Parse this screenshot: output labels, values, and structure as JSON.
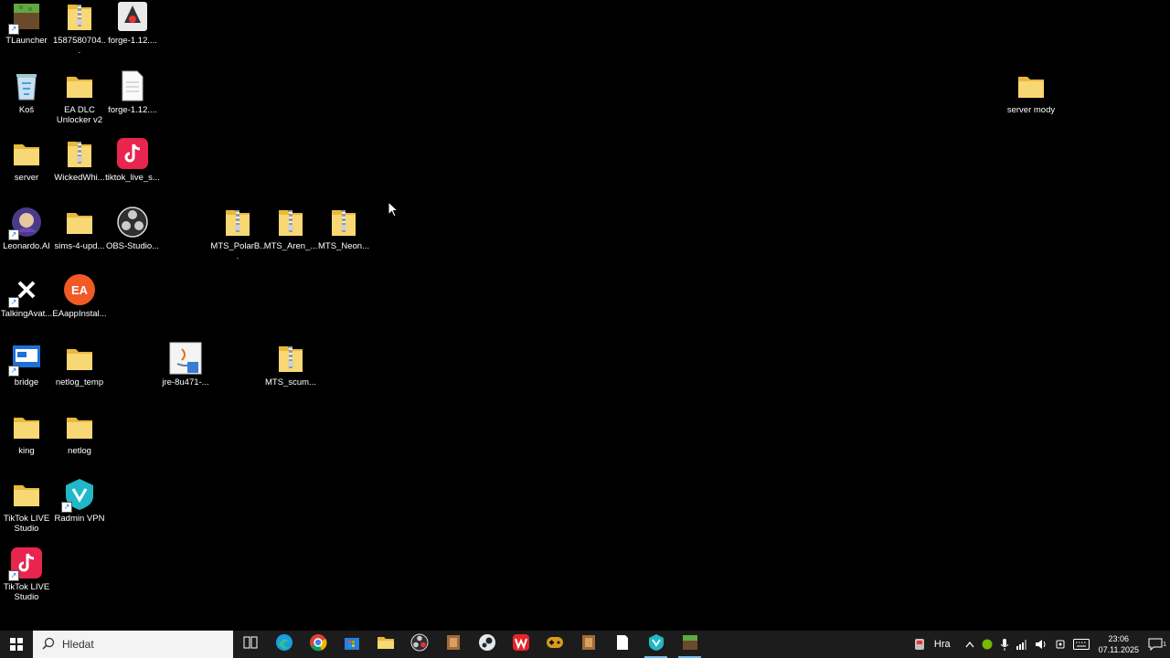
{
  "desktop_icons": [
    {
      "label": "TLauncher",
      "kind": "tlauncher"
    },
    {
      "label": "1587580704...",
      "kind": "zip"
    },
    {
      "label": "forge-1.12....",
      "kind": "java"
    },
    {
      "label": "Koš",
      "kind": "recycle"
    },
    {
      "label": "EA DLC Unlocker v2",
      "kind": "folder"
    },
    {
      "label": "forge-1.12....",
      "kind": "file"
    },
    {
      "label": "server",
      "kind": "folder"
    },
    {
      "label": "WickedWhi...",
      "kind": "zip"
    },
    {
      "label": "tiktok_live_s...",
      "kind": "tiktok"
    },
    {
      "label": "Leonardo.AI",
      "kind": "leonardo"
    },
    {
      "label": "sims-4-upd...",
      "kind": "folder"
    },
    {
      "label": "OBS-Studio...",
      "kind": "obs"
    },
    {
      "label": "MTS_PolarB...",
      "kind": "zip"
    },
    {
      "label": "MTS_Aren_...",
      "kind": "zip"
    },
    {
      "label": "MTS_Neon...",
      "kind": "zip"
    },
    {
      "label": "TalkingAvat...",
      "kind": "capcut"
    },
    {
      "label": "EAappInstal...",
      "kind": "ea"
    },
    {
      "label": "bridge",
      "kind": "bridge"
    },
    {
      "label": "netlog_temp",
      "kind": "folder"
    },
    {
      "label": "jre-8u471-...",
      "kind": "jre"
    },
    {
      "label": "MTS_scum...",
      "kind": "zip"
    },
    {
      "label": "king",
      "kind": "folder"
    },
    {
      "label": "netlog",
      "kind": "folder"
    },
    {
      "label": "TikTok LIVE Studio",
      "kind": "folder"
    },
    {
      "label": "Radmin VPN",
      "kind": "radmin"
    },
    {
      "label": "TikTok LIVE Studio",
      "kind": "tiktok"
    },
    {
      "label": "server mody",
      "kind": "folder"
    }
  ],
  "taskbar": {
    "search_placeholder": "Hledat",
    "apps": [
      {
        "name": "task-view-icon"
      },
      {
        "name": "edge-icon"
      },
      {
        "name": "chrome-icon"
      },
      {
        "name": "store-icon"
      },
      {
        "name": "file-explorer-icon"
      },
      {
        "name": "obs-icon"
      },
      {
        "name": "app-icon"
      },
      {
        "name": "steam-icon"
      },
      {
        "name": "wps-icon"
      },
      {
        "name": "game-icon"
      },
      {
        "name": "app-icon"
      },
      {
        "name": "notepad-icon"
      },
      {
        "name": "radmin-icon"
      },
      {
        "name": "tlauncher-icon"
      }
    ],
    "tray": {
      "game_label": "Hra",
      "time": "23:06",
      "date": "07.11.2025",
      "notification_count": "1"
    }
  }
}
